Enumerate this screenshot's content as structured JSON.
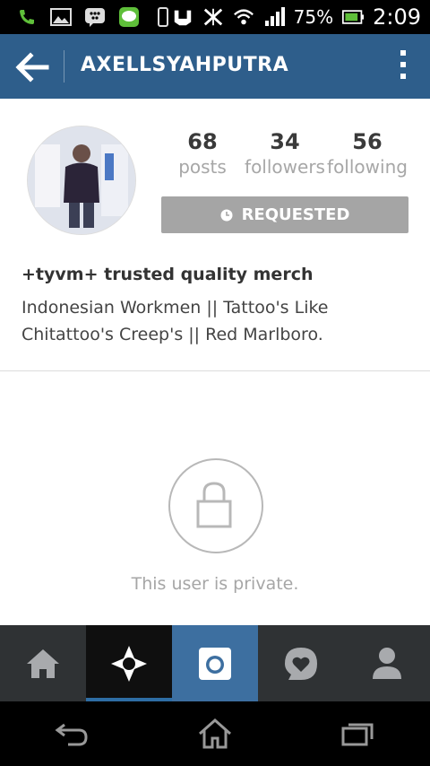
{
  "status_bar": {
    "battery_percent": "75%",
    "time": "2:09",
    "icons": [
      "phone-icon",
      "gallery-icon",
      "bbm-icon",
      "line-icon",
      "phone-device-icon",
      "nfc-icon",
      "muted-icon",
      "wifi-icon",
      "signal-icon",
      "battery-icon"
    ]
  },
  "app_bar": {
    "title": "AXELLSYAHPUTRA"
  },
  "profile": {
    "stats": [
      {
        "value": "68",
        "label": "posts"
      },
      {
        "value": "34",
        "label": "followers"
      },
      {
        "value": "56",
        "label": "following"
      }
    ],
    "follow_button_label": "REQUESTED",
    "bio_name": "+tyvm+ trusted quality merch",
    "bio_line1": "Indonesian Workmen || Tattoo's Like",
    "bio_line2": "Chitattoo's Creep's || Red Marlboro."
  },
  "private_message": "This user is private.",
  "tabs": [
    "home-icon",
    "explore-icon",
    "camera-icon",
    "activity-icon",
    "profile-icon"
  ],
  "colors": {
    "app_bar": "#2e5e8b",
    "requested_button": "#a5a5a5",
    "tab_bar": "#2f3234",
    "camera_tab": "#3d6fa0"
  }
}
